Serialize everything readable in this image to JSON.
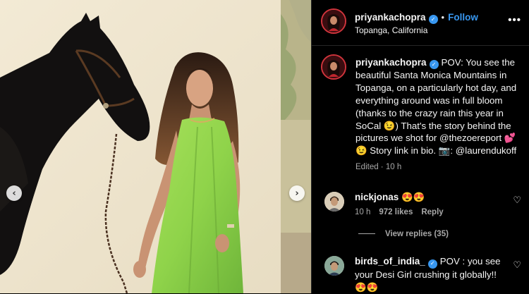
{
  "post": {
    "username": "priyankachopra",
    "follow_label": "Follow",
    "location": "Topanga, California",
    "more_label": "•••",
    "caption_text": "POV: You see the beautiful Santa Monica Mountains in Topanga, on a particularly hot day, and everything around was in full bloom (thanks to the crazy rain this year in SoCal 😉) That's the story behind the pictures we shot for @thezoereport 💕 😉 Story link in bio. 📷: @laurendukoff",
    "edited_time": "Edited · 10 h"
  },
  "media": {
    "prev_icon": "‹",
    "next_icon": "›"
  },
  "comments": [
    {
      "username": "nickjonas",
      "text": "😍😍",
      "time": "10 h",
      "likes": "972 likes",
      "reply_label": "Reply",
      "view_replies": "View replies (35)"
    },
    {
      "username": "birds_of_india_",
      "text": "POV : you see your Desi Girl crushing it globally!! 😍😍"
    }
  ],
  "icons": {
    "verified": "✓",
    "heart": "♡"
  },
  "colors": {
    "accent": "#3897f0",
    "dress": "#8fd34a",
    "background": "#000000"
  }
}
